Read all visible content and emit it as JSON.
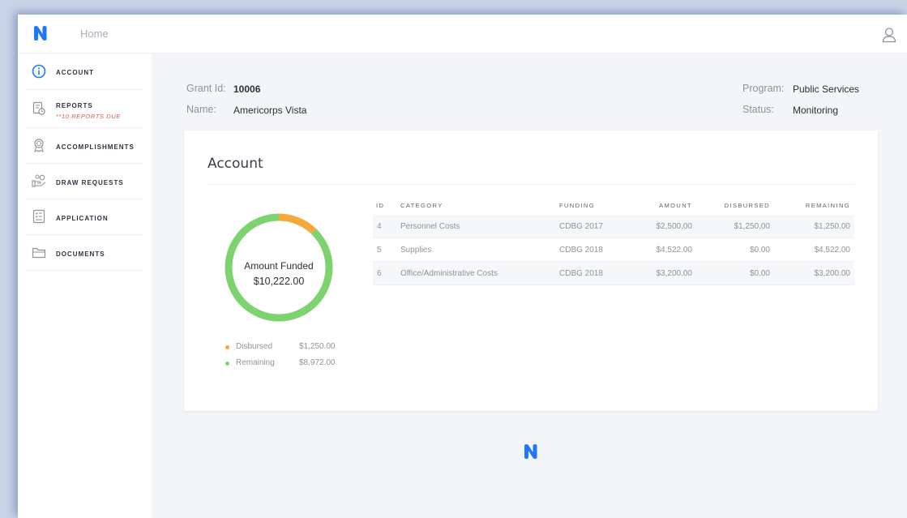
{
  "header": {
    "home_label": "Home",
    "logo_icon": "n-logo-icon",
    "user_icon": "user-profile-icon",
    "accent_color": "#1e78ff"
  },
  "sidebar": {
    "items": [
      {
        "label": "ACCOUNT",
        "icon": "info-circle-icon"
      },
      {
        "label": "REPORTS",
        "sub": "**10 REPORTS DUE",
        "icon": "reports-icon"
      },
      {
        "label": "ACCOMPLISHMENTS",
        "icon": "award-ribbon-icon"
      },
      {
        "label": "DRAW REQUESTS",
        "icon": "money-hand-icon"
      },
      {
        "label": "APPLICATION",
        "icon": "checklist-icon"
      },
      {
        "label": "DOCUMENTS",
        "icon": "folder-icon"
      }
    ]
  },
  "grant": {
    "id_label": "Grant Id:",
    "id_value": "10006",
    "name_label": "Name:",
    "name_value": "Americorps Vista",
    "program_label": "Program:",
    "program_value": "Public Services",
    "status_label": "Status:",
    "status_value": "Monitoring"
  },
  "account": {
    "title": "Account",
    "donut": {
      "label": "Amount Funded",
      "total": "$10,222.00",
      "disbursed_color": "#f5a93a",
      "remaining_color": "#7dd46f"
    },
    "legend": [
      {
        "name": "Disbursed",
        "value": "$1,250.00"
      },
      {
        "name": "Remaining",
        "value": "$8,972.00"
      }
    ],
    "table": {
      "headers": [
        "ID",
        "CATEGORY",
        "FUNDING",
        "AMOUNT",
        "DISBURSED",
        "REMAINING"
      ],
      "rows": [
        {
          "id": "4",
          "category": "Personnel Costs",
          "funding": "CDBG 2017",
          "amount": "$2,500.00",
          "disbursed": "$1,250.00",
          "remaining": "$1,250.00"
        },
        {
          "id": "5",
          "category": "Supplies",
          "funding": "CDBG 2018",
          "amount": "$4,522.00",
          "disbursed": "$0.00",
          "remaining": "$4,522.00"
        },
        {
          "id": "6",
          "category": "Office/Administrative Costs",
          "funding": "CDBG 2018",
          "amount": "$3,200.00",
          "disbursed": "$0.00",
          "remaining": "$3,200.00"
        }
      ]
    }
  },
  "chart_data": {
    "type": "pie",
    "categories": [
      "Disbursed",
      "Remaining"
    ],
    "values": [
      1250,
      8972
    ],
    "title": "Amount Funded"
  },
  "footer": {
    "logo_icon": "n-logo-icon"
  }
}
